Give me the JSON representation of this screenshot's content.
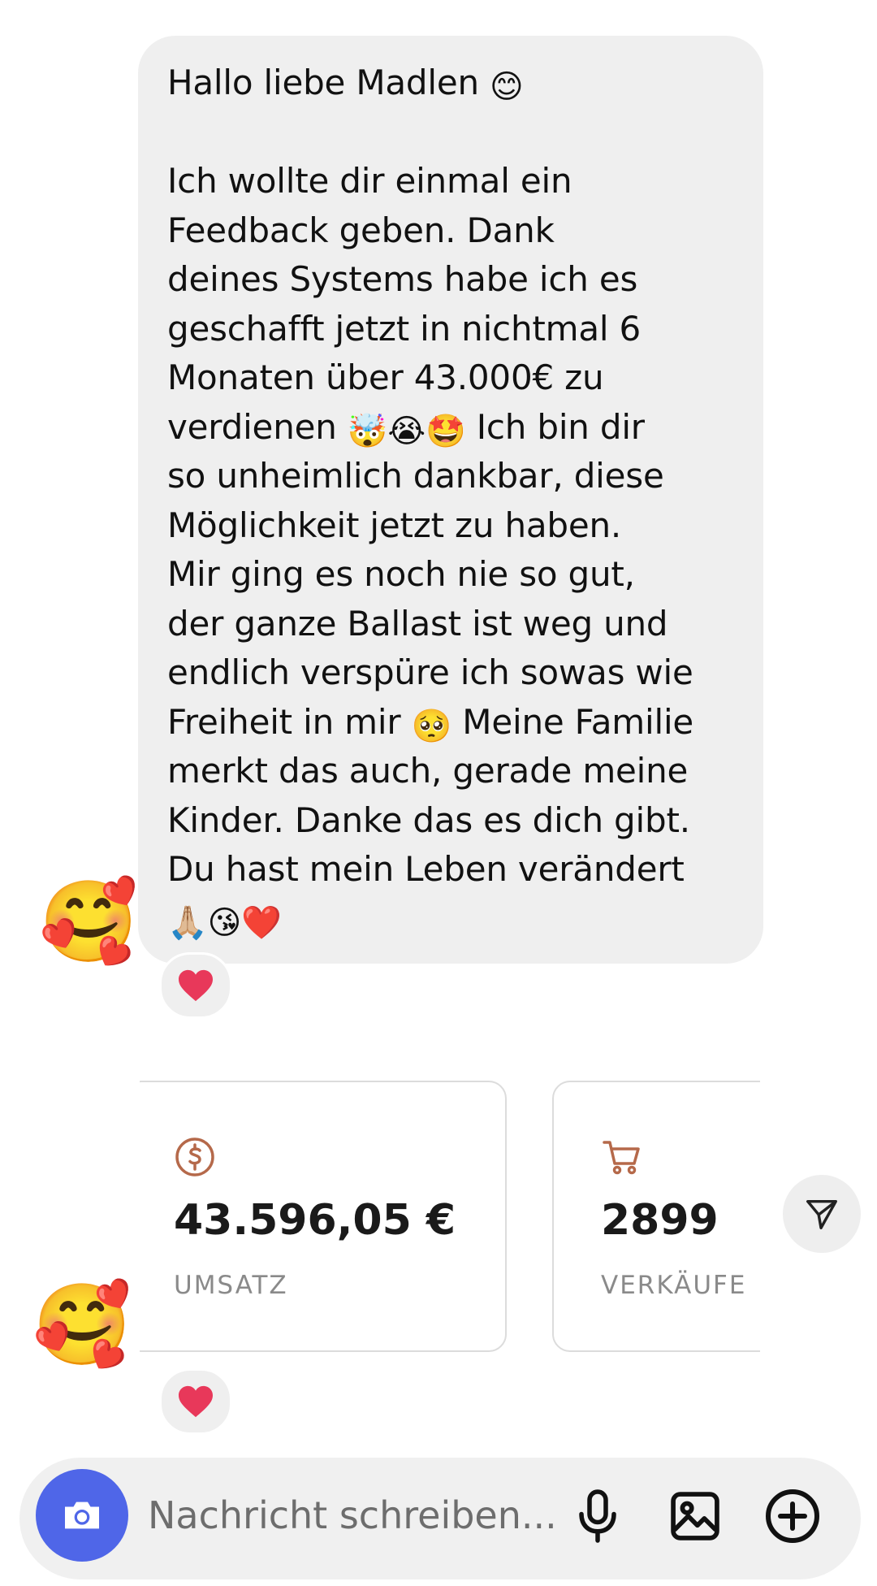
{
  "message": {
    "lines": [
      {
        "text": "Hallo liebe Madlen ",
        "emoji": "😊"
      },
      {
        "text": "",
        "emoji": ""
      },
      {
        "text": "Ich wollte dir einmal ein",
        "emoji": ""
      },
      {
        "text": "Feedback geben. Dank",
        "emoji": ""
      },
      {
        "text": "deines Systems habe ich es",
        "emoji": ""
      },
      {
        "text": "geschafft jetzt in nichtmal 6",
        "emoji": ""
      },
      {
        "text": "Monaten über 43.000€ zu",
        "emoji": ""
      }
    ],
    "line_verdienen_pre": "verdienen ",
    "line_verdienen_emoji": "🤯😭🤩",
    "line_verdienen_post": " Ich bin dir",
    "lines2": [
      "so unheimlich dankbar, diese",
      "Möglichkeit jetzt zu haben.",
      "Mir ging es noch nie so gut,",
      "der ganze Ballast ist weg und",
      "endlich verspüre ich sowas wie"
    ],
    "line_freiheit_pre": "Freiheit in mir ",
    "line_freiheit_emoji": "🥺",
    "line_freiheit_post": " Meine Familie",
    "lines3": [
      "merkt das auch, gerade meine",
      "Kinder. Danke das es dich gibt.",
      "Du hast mein Leben verändert"
    ],
    "closing_emoji": "🙏🏼😘❤️"
  },
  "avatar_emoji": "🥰",
  "reaction_emoji": "❤️",
  "cards": [
    {
      "value": "43.596,05 €",
      "label": "UMSATZ",
      "icon": "dollar-circle-icon"
    },
    {
      "value": "2899",
      "label": "VERKÄUFE",
      "icon": "shopping-cart-icon"
    }
  ],
  "composer": {
    "placeholder": "Nachricht schreiben..."
  },
  "colors": {
    "bubble": "#efefef",
    "accent_blue": "#4f66e8",
    "icon_brown": "#b5694a",
    "heart": "#e8385a"
  }
}
